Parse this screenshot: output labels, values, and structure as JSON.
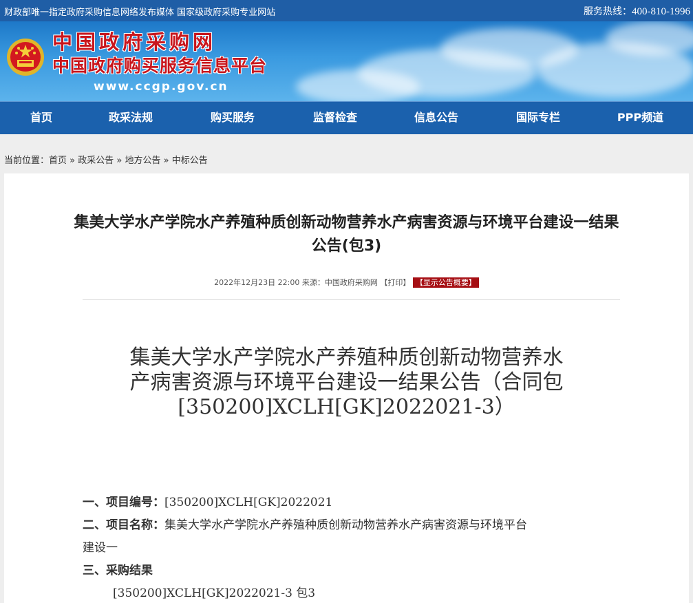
{
  "topbar": {
    "left_text": "财政部唯一指定政府采购信息网络发布媒体 国家级政府采购专业网站",
    "hotline_label": "服务热线：",
    "hotline_number": "400-810-1996"
  },
  "brand": {
    "name_cn": "中国政府采购网",
    "subtitle": "中国政府购买服务信息平台",
    "url": "www.ccgp.gov.cn"
  },
  "nav": [
    {
      "label": "首页"
    },
    {
      "label": "政采法规"
    },
    {
      "label": "购买服务"
    },
    {
      "label": "监督检查"
    },
    {
      "label": "信息公告"
    },
    {
      "label": "国际专栏"
    },
    {
      "label": "PPP频道"
    }
  ],
  "breadcrumb": {
    "prefix": "当前位置：",
    "items": [
      "首页",
      "政采公告",
      "地方公告",
      "中标公告"
    ],
    "sep": " » "
  },
  "article": {
    "title_line1": "集美大学水产学院水产养殖种质创新动物营养水产病害资源与环境平台建设一结果",
    "title_line2": "公告(包3)",
    "date": "2022年12月23日 22:00",
    "source_label": "来源：",
    "source": "中国政府采购网",
    "print_label": "【打印】",
    "summary_button": "【显示公告概要】"
  },
  "document": {
    "title_line1": "集美大学水产学院水产养殖种质创新动物营养水",
    "title_line2": "产病害资源与环境平台建设一结果公告（合同包",
    "title_line3": "[350200]XCLH[GK]2022021-3）",
    "items": {
      "item1_label": "一、项目编号：",
      "item1_value": "[350200]XCLH[GK]2022021",
      "item2_label": "二、项目名称：",
      "item2_value_line1": "集美大学水产学院水产养殖种质创新动物营养水产病害资源与环境平台",
      "item2_value_line2": "建设一",
      "item3_label": "三、采购结果",
      "item3_sub": "[350200]XCLH[GK]2022021-3 包3"
    }
  }
}
